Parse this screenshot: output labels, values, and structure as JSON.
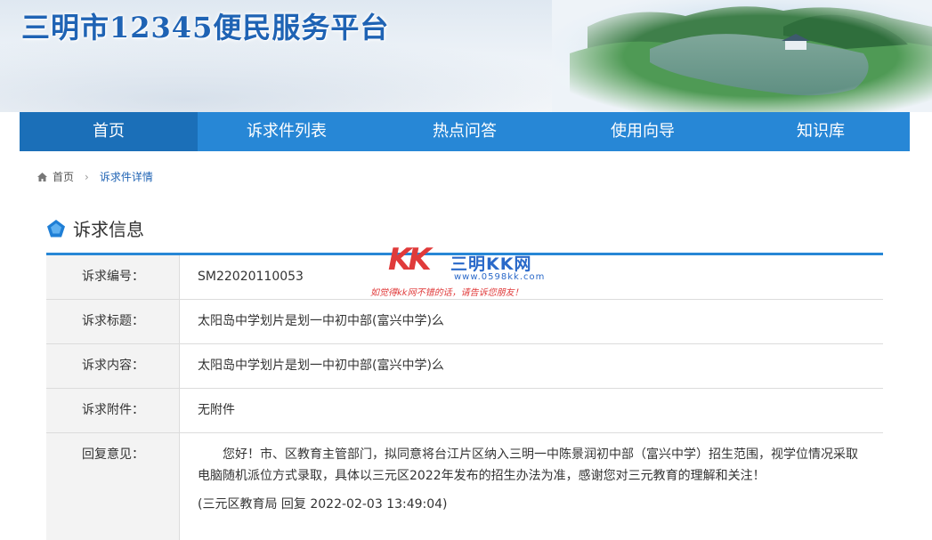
{
  "site": {
    "title": "三明市12345便民服务平台"
  },
  "nav": {
    "items": [
      {
        "label": "首页",
        "active": true
      },
      {
        "label": "诉求件列表",
        "active": false
      },
      {
        "label": "热点问答",
        "active": false
      },
      {
        "label": "使用向导",
        "active": false
      },
      {
        "label": "知识库",
        "active": false
      }
    ]
  },
  "breadcrumb": {
    "home": "首页",
    "current": "诉求件详情"
  },
  "section": {
    "title": "诉求信息"
  },
  "details": {
    "number_label": "诉求编号：",
    "number_value": "SM22020110053",
    "title_label": "诉求标题：",
    "title_value": "太阳岛中学划片是划一中初中部(富兴中学)么",
    "content_label": "诉求内容：",
    "content_value": "太阳岛中学划片是划一中初中部(富兴中学)么",
    "attachment_label": "诉求附件：",
    "attachment_value": "无附件",
    "reply_label": "回复意见：",
    "reply_text": "您好！市、区教育主管部门，拟同意将台江片区纳入三明一中陈景润初中部（富兴中学）招生范围，视学位情况采取电脑随机派位方式录取，具体以三元区2022年发布的招生办法为准，感谢您对三元教育的理解和关注！",
    "reply_sign": "(三元区教育局 回复 2022-02-03 13:49:04)"
  },
  "watermark": {
    "logo": "KK",
    "name": "三明KK网",
    "url": "www.0598kk.com",
    "note": "如觉得kk网不错的话，请告诉您朋友！"
  },
  "colors": {
    "brand": "#2787d6",
    "nav_active": "#1b6fb8",
    "title": "#1f63b4",
    "watermark_red": "#e03a3a"
  }
}
